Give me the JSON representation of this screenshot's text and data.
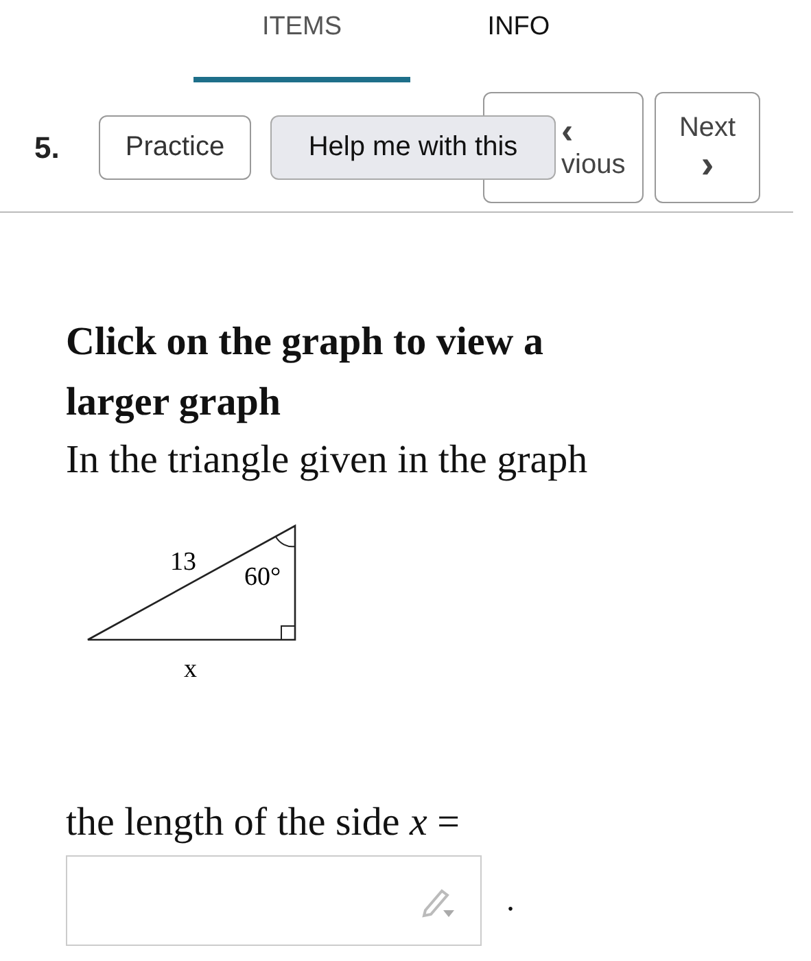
{
  "tabs": [
    {
      "label": "ITEMS",
      "selected": true
    },
    {
      "label": "INFO",
      "selected": false
    }
  ],
  "toolbar": {
    "question_number": "5.",
    "practice_button": "Practice",
    "help_button": "Help me with this",
    "previous_button": {
      "icon": "‹",
      "label": "vious"
    },
    "next_button": {
      "label": "Next",
      "icon": "›"
    }
  },
  "question": {
    "heading": "Click on the graph to view a larger graph",
    "intro": "In the triangle given in the graph",
    "diagram": {
      "hypotenuse": "13",
      "angle": "60°",
      "base": "x"
    },
    "prompt": "the length of the side *x* =",
    "trailing": "."
  }
}
